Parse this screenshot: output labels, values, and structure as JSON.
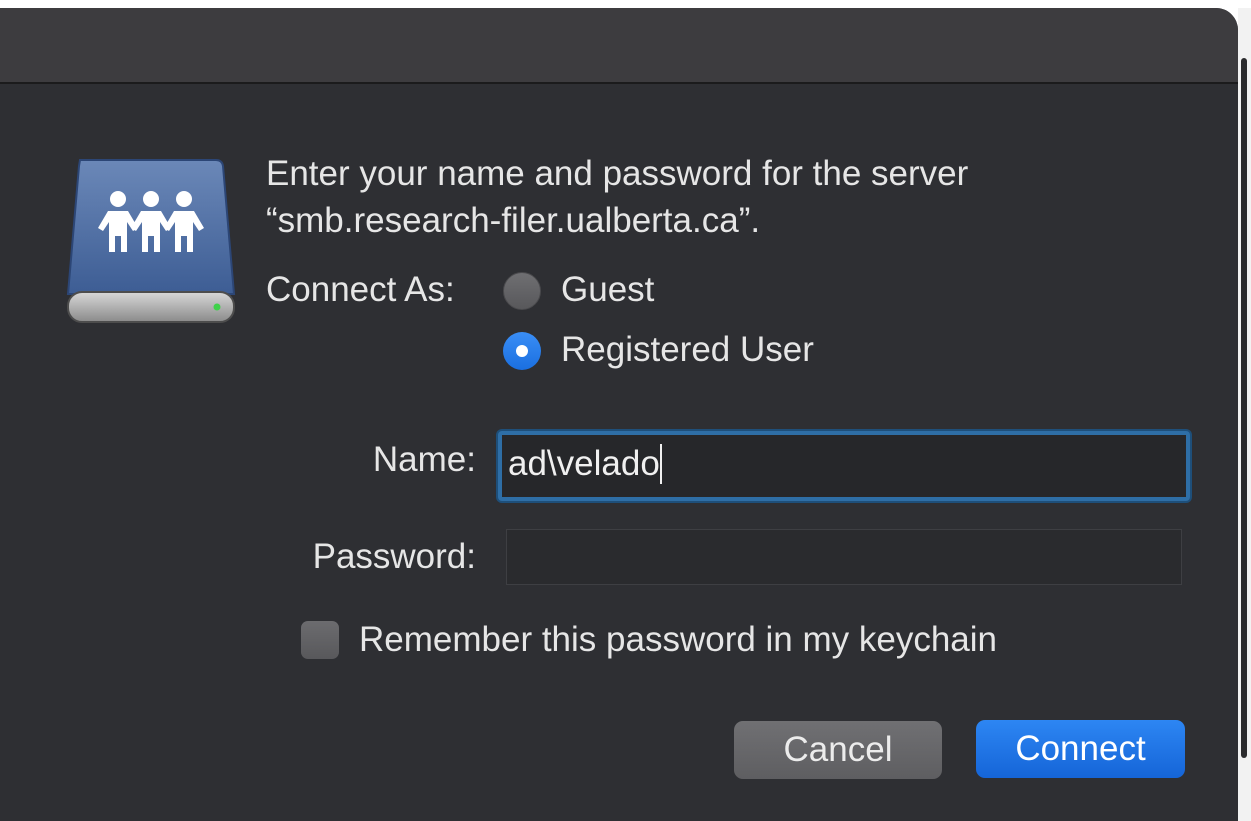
{
  "dialog": {
    "prompt_line1": "Enter your name and password for the server",
    "prompt_line2": "“smb.research-filer.ualberta.ca”.",
    "connect_as_label": "Connect As:",
    "options": [
      {
        "label": "Guest",
        "selected": false
      },
      {
        "label": "Registered User",
        "selected": true
      }
    ],
    "name_label": "Name:",
    "name_value": "ad\\velado",
    "password_label": "Password:",
    "password_value": "",
    "remember_label": "Remember this password in my keychain",
    "remember_checked": false,
    "cancel_label": "Cancel",
    "connect_label": "Connect"
  },
  "icons": {
    "server": "shared-server-icon"
  },
  "colors": {
    "accent": "#1a6fe0",
    "background": "#2e2f33",
    "titlebar": "#3d3c3f",
    "focus_ring": "#2e6ea6"
  }
}
